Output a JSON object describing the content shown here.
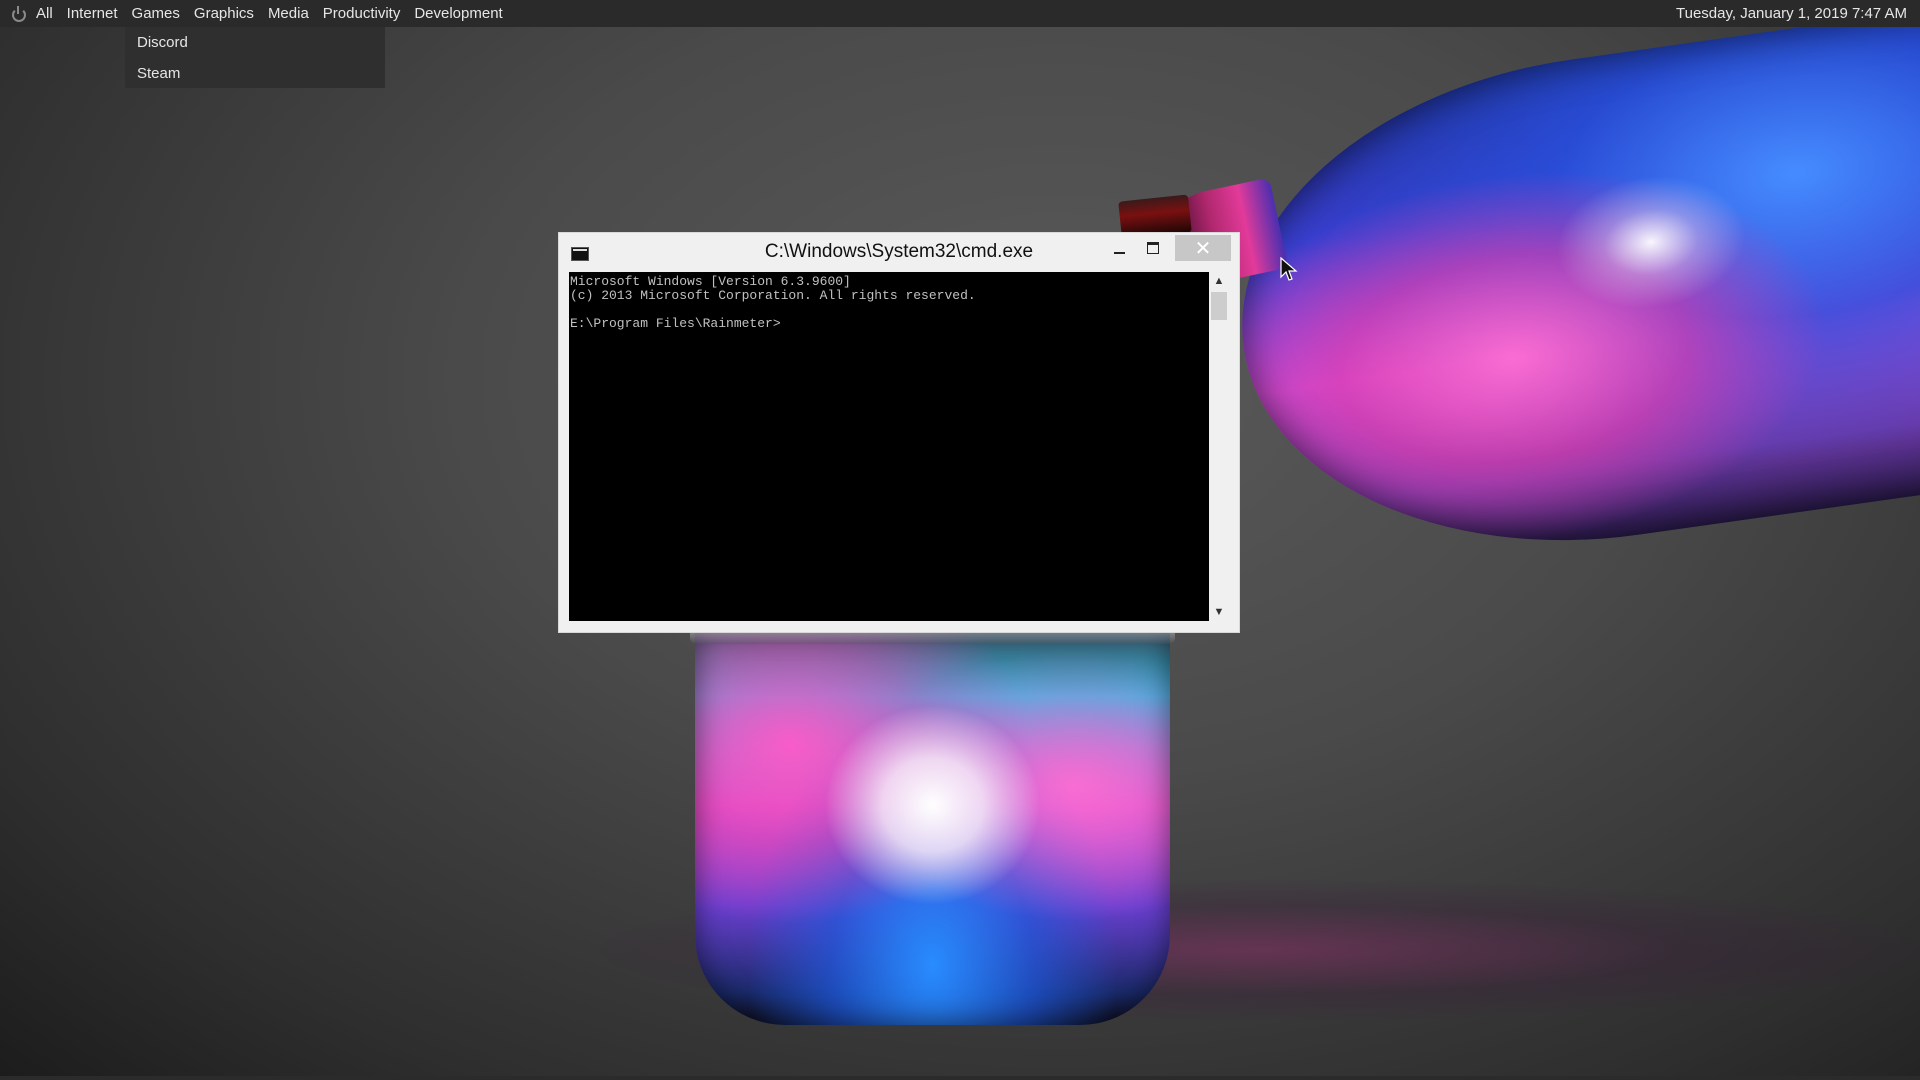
{
  "menubar": {
    "items": [
      "All",
      "Internet",
      "Games",
      "Graphics",
      "Media",
      "Productivity",
      "Development"
    ],
    "clock": "Tuesday, January 1, 2019 7:47 AM"
  },
  "dropdown": {
    "parent": "Games",
    "items": [
      "Discord",
      "Steam"
    ]
  },
  "window": {
    "title": "C:\\Windows\\System32\\cmd.exe",
    "close_glyph": "✕",
    "console_lines": [
      "Microsoft Windows [Version 6.3.9600]",
      "(c) 2013 Microsoft Corporation. All rights reserved.",
      "",
      "E:\\Program Files\\Rainmeter>"
    ]
  },
  "icons": [
    "power-icon",
    "cmd-app-icon",
    "minimize-icon",
    "maximize-icon",
    "close-icon",
    "scroll-up-icon",
    "scroll-down-icon",
    "mouse-cursor-icon"
  ]
}
